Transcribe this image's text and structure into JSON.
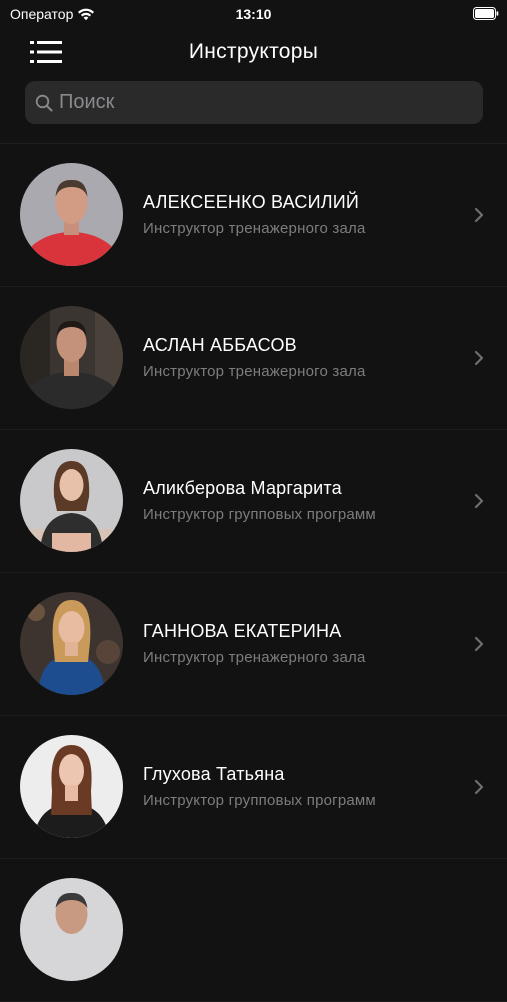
{
  "status_bar": {
    "carrier": "Оператор",
    "time": "13:10"
  },
  "nav": {
    "title": "Инструкторы",
    "menu_icon": "hamburger-menu-icon"
  },
  "search": {
    "placeholder": "Поиск",
    "value": ""
  },
  "instructors": [
    {
      "name": "АЛЕКСЕЕНКО ВАСИЛИЙ",
      "role": "Инструктор тренажерного зала",
      "shirt_color": "#d9333b"
    },
    {
      "name": "АСЛАН АББАСОВ",
      "role": "Инструктор тренажерного зала",
      "shirt_color": "#2b2b2b"
    },
    {
      "name": "Аликберова Маргарита",
      "role": "Инструктор групповых программ",
      "shirt_color": "#2e2e2e"
    },
    {
      "name": "ГАННОВА ЕКАТЕРИНА",
      "role": "Инструктор тренажерного зала",
      "shirt_color": "#1e4d8f"
    },
    {
      "name": "Глухова Татьяна",
      "role": "Инструктор групповых программ",
      "shirt_color": "#1c1c1c"
    }
  ],
  "colors": {
    "background": "#121212",
    "search_field": "#2a2a2a",
    "secondary_text": "#7d7d80",
    "chevron": "#6e6e72"
  }
}
